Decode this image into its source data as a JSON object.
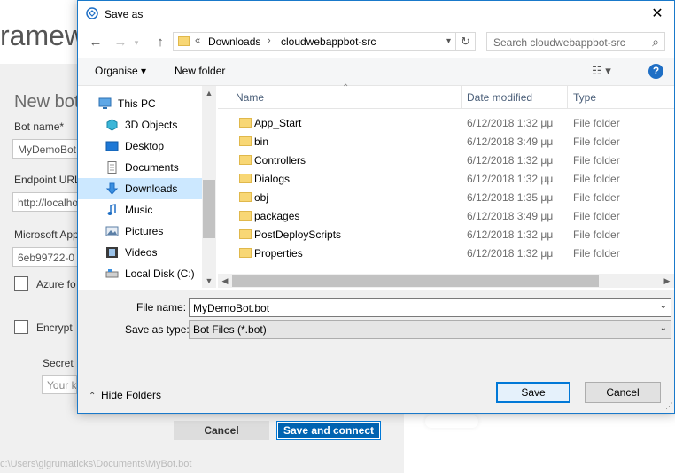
{
  "background": {
    "brand_text": "ramew",
    "heading": "New bot",
    "fields": [
      {
        "label": "Bot name*",
        "value": "MyDemoBot"
      },
      {
        "label": "Endpoint URL",
        "value": "http://localhost"
      },
      {
        "label": "Microsoft App ID",
        "value": "6eb99722-0"
      }
    ],
    "azure_check_label": "Azure fo",
    "encrypt_check_label": "Encrypt",
    "secret_label": "Secret",
    "secret_placeholder": "Your k",
    "cancel_label": "Cancel",
    "save_connect_label": "Save and connect",
    "path_text": "c:\\Users\\gigrumaticks\\Documents\\MyBot.bot"
  },
  "dialog": {
    "title": "Save as",
    "address": {
      "prefix": "«",
      "crumbs": [
        "Downloads",
        "cloudwebappbot-src"
      ],
      "separator": "›"
    },
    "search_placeholder": "Search cloudwebappbot-src",
    "toolbar": {
      "organise_label": "Organise ▾",
      "new_folder_label": "New folder",
      "view_label": "☷ ▾",
      "help_label": "?"
    },
    "nav_items": [
      {
        "label": "This PC",
        "icon": "computer-icon"
      },
      {
        "label": "3D Objects",
        "icon": "cube-icon"
      },
      {
        "label": "Desktop",
        "icon": "desktop-icon"
      },
      {
        "label": "Documents",
        "icon": "document-icon"
      },
      {
        "label": "Downloads",
        "icon": "download-icon",
        "selected": true
      },
      {
        "label": "Music",
        "icon": "music-icon"
      },
      {
        "label": "Pictures",
        "icon": "pictures-icon"
      },
      {
        "label": "Videos",
        "icon": "video-icon"
      },
      {
        "label": "Local Disk (C:)",
        "icon": "disk-icon"
      }
    ],
    "columns": {
      "name": "Name",
      "date": "Date modified",
      "type": "Type"
    },
    "files": [
      {
        "name": "App_Start",
        "date": "6/12/2018 1:32 μμ",
        "type": "File folder"
      },
      {
        "name": "bin",
        "date": "6/12/2018 3:49 μμ",
        "type": "File folder"
      },
      {
        "name": "Controllers",
        "date": "6/12/2018 1:32 μμ",
        "type": "File folder"
      },
      {
        "name": "Dialogs",
        "date": "6/12/2018 1:32 μμ",
        "type": "File folder"
      },
      {
        "name": "obj",
        "date": "6/12/2018 1:35 μμ",
        "type": "File folder"
      },
      {
        "name": "packages",
        "date": "6/12/2018 3:49 μμ",
        "type": "File folder"
      },
      {
        "name": "PostDeployScripts",
        "date": "6/12/2018 1:32 μμ",
        "type": "File folder"
      },
      {
        "name": "Properties",
        "date": "6/12/2018 1:32 μμ",
        "type": "File folder"
      }
    ],
    "file_name_label": "File name:",
    "file_name_value": "MyDemoBot.bot",
    "save_type_label": "Save as type:",
    "save_type_value": "Bot Files (*.bot)",
    "hide_folders_label": "Hide Folders",
    "save_label": "Save",
    "cancel_label": "Cancel"
  }
}
